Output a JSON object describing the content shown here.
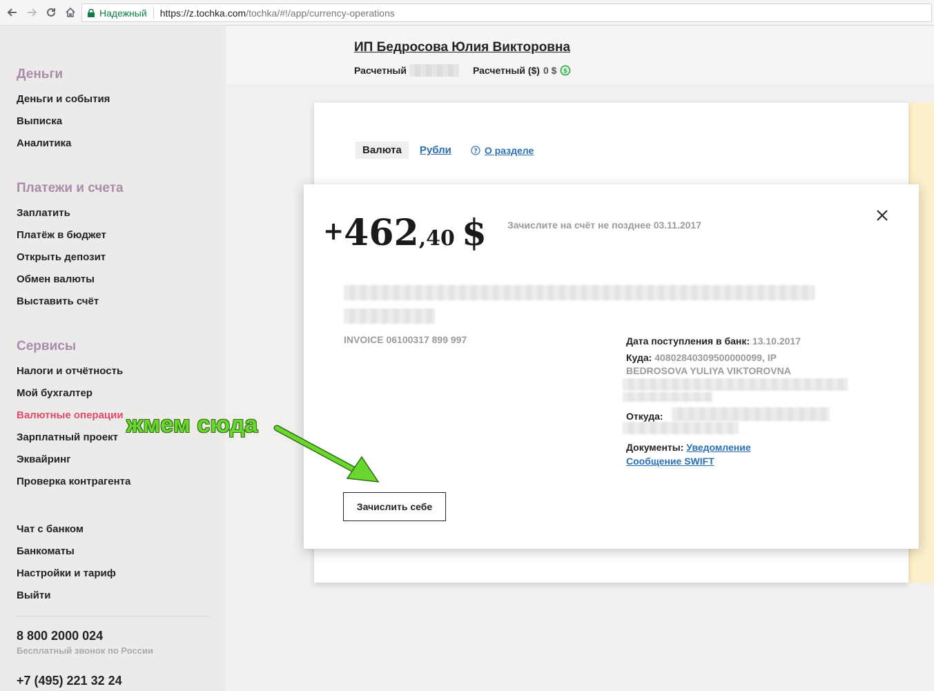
{
  "browser": {
    "secure_label": "Надежный",
    "url_host": "https://z.tochka.com",
    "url_path": "/tochka/#!/app/currency-operations"
  },
  "sidebar": {
    "groups": [
      {
        "title": "Деньги",
        "items": [
          "Деньги и события",
          "Выписка",
          "Аналитика"
        ]
      },
      {
        "title": "Платежи и счета",
        "items": [
          "Заплатить",
          "Платёж в бюджет",
          "Открыть депозит",
          "Обмен валюты",
          "Выставить счёт"
        ]
      },
      {
        "title": "Сервисы",
        "items": [
          "Налоги и отчётность",
          "Мой бухгалтер",
          "Валютные операции",
          "Зарплатный проект",
          "Эквайринг",
          "Проверка контрагента"
        ]
      }
    ],
    "extra_items": [
      "Чат с банком",
      "Банкоматы",
      "Настройки и тариф",
      "Выйти"
    ],
    "phone1": "8 800 2000 024",
    "phone1_note": "Бесплатный звонок по России",
    "phone2": "+7 (495) 221 32 24"
  },
  "header": {
    "company": "ИП Бедросова Юлия Викторовна",
    "account1_label": "Расчетный",
    "account2_label": "Расчетный ($)",
    "account2_balance": "0 $"
  },
  "tabs": {
    "active": "Валюта",
    "rubles": "Рубли",
    "about": "О разделе"
  },
  "modal": {
    "amount_sign": "+",
    "amount_int": "462",
    "amount_dec": ",40",
    "amount_currency": "$",
    "deadline": "Зачислите на счёт не позднее 03.11.2017",
    "invoice": "INVOICE 06100317 899 997",
    "date_label": "Дата поступления в банк:",
    "date_value": "13.10.2017",
    "to_label": "Куда:",
    "to_value_line1": "40802840309500000099, IP",
    "to_value_line2": "BEDROSOVA YULIYA VIKTOROVNA",
    "from_label": "Откуда:",
    "docs_label": "Документы:",
    "doc1": "Уведомление",
    "doc2": "Сообщение SWIFT",
    "credit_button": "Зачислить себе"
  },
  "annotation": {
    "text": "жмем сюда",
    "color": "#6bd62f"
  },
  "colors": {
    "accent_link": "#2a6fb5",
    "active_menu": "#e14a6b",
    "group_title": "#a98bab",
    "secure_green": "#0b8043"
  }
}
